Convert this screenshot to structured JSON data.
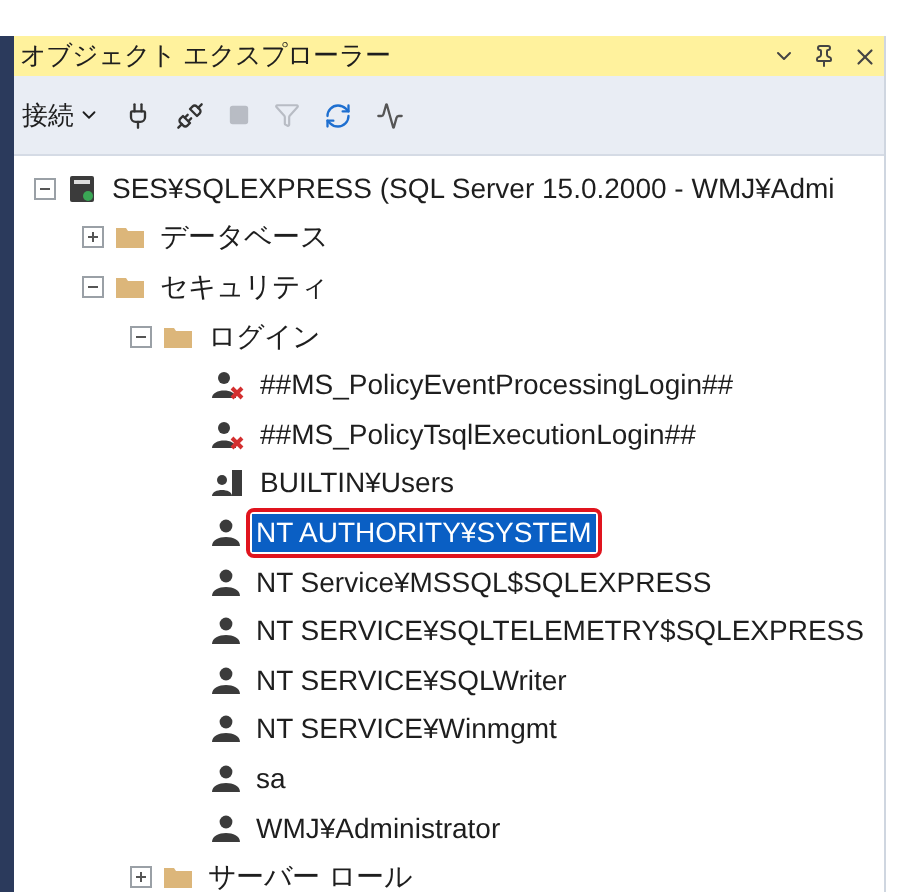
{
  "panel": {
    "title": "オブジェクト エクスプローラー"
  },
  "toolbar": {
    "connect_label": "接続"
  },
  "tree": [
    {
      "label": "SES¥SQLEXPRESS (SQL Server 15.0.2000 - WMJ¥Admi",
      "kind": "server",
      "expanded": true,
      "selected": false,
      "children": [
        {
          "label": "データベース",
          "kind": "folder",
          "expanded": false,
          "selected": false
        },
        {
          "label": "セキュリティ",
          "kind": "folder",
          "expanded": true,
          "selected": false,
          "children": [
            {
              "label": "ログイン",
              "kind": "folder",
              "expanded": true,
              "selected": false,
              "children": [
                {
                  "label": "##MS_PolicyEventProcessingLogin##",
                  "kind": "disabled-login",
                  "selected": false,
                  "callout": false
                },
                {
                  "label": "##MS_PolicyTsqlExecutionLogin##",
                  "kind": "disabled-login",
                  "selected": false,
                  "callout": false
                },
                {
                  "label": "BUILTIN¥Users",
                  "kind": "group-login",
                  "selected": false,
                  "callout": false
                },
                {
                  "label": "NT AUTHORITY¥SYSTEM",
                  "kind": "login",
                  "selected": true,
                  "callout": true
                },
                {
                  "label": "NT Service¥MSSQL$SQLEXPRESS",
                  "kind": "login",
                  "selected": false,
                  "callout": false
                },
                {
                  "label": "NT SERVICE¥SQLTELEMETRY$SQLEXPRESS",
                  "kind": "login",
                  "selected": false,
                  "callout": false
                },
                {
                  "label": "NT SERVICE¥SQLWriter",
                  "kind": "login",
                  "selected": false,
                  "callout": false
                },
                {
                  "label": "NT SERVICE¥Winmgmt",
                  "kind": "login",
                  "selected": false,
                  "callout": false
                },
                {
                  "label": "sa",
                  "kind": "login",
                  "selected": false,
                  "callout": false
                },
                {
                  "label": "WMJ¥Administrator",
                  "kind": "login",
                  "selected": false,
                  "callout": false
                }
              ]
            },
            {
              "label": "サーバー ロール",
              "kind": "folder",
              "expanded": false,
              "selected": false
            }
          ]
        }
      ]
    }
  ]
}
